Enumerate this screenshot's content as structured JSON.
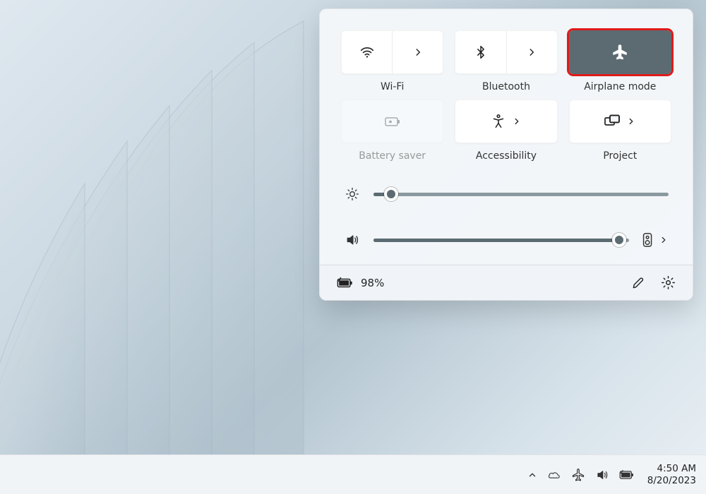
{
  "panel": {
    "tiles": [
      {
        "id": "wifi",
        "label": "Wi-Fi",
        "split": true,
        "active": false,
        "disabled": false,
        "highlight": false
      },
      {
        "id": "bluetooth",
        "label": "Bluetooth",
        "split": true,
        "active": false,
        "disabled": false,
        "highlight": false
      },
      {
        "id": "airplane",
        "label": "Airplane mode",
        "split": false,
        "active": true,
        "disabled": false,
        "highlight": true
      },
      {
        "id": "battery-saver",
        "label": "Battery saver",
        "split": false,
        "active": false,
        "disabled": true,
        "highlight": false
      },
      {
        "id": "accessibility",
        "label": "Accessibility",
        "split": false,
        "expand": true,
        "active": false,
        "disabled": false,
        "highlight": false
      },
      {
        "id": "project",
        "label": "Project",
        "split": false,
        "expand": true,
        "active": false,
        "disabled": false,
        "highlight": false
      }
    ],
    "brightness_pct": 6,
    "volume_pct": 96,
    "battery_text": "98%"
  },
  "taskbar": {
    "time": "4:50 AM",
    "date": "8/20/2023"
  },
  "colors": {
    "highlight": "#e01a1a",
    "active_tile": "#5c6b72"
  }
}
